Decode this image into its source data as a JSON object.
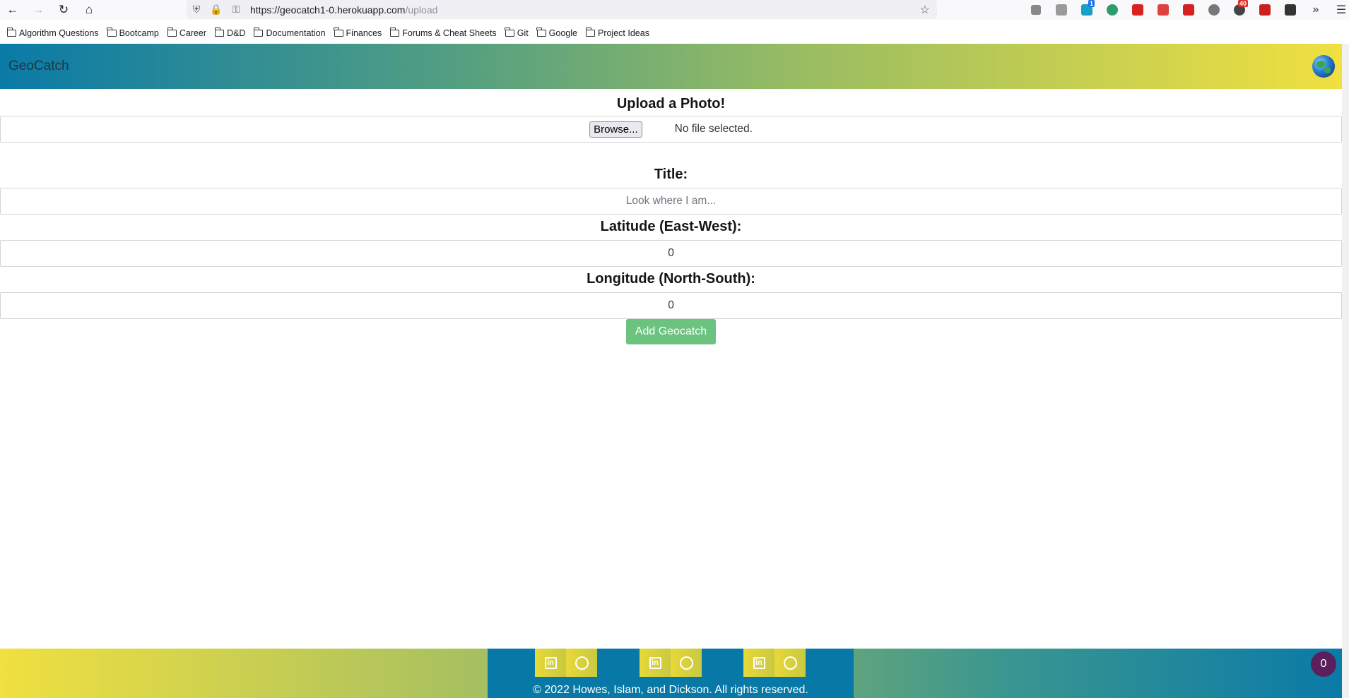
{
  "browser": {
    "url_host": "https://geocatch1-0.herokuapp.com",
    "url_path": "/upload",
    "bookmarks": [
      "Algorithm Questions",
      "Bootcamp",
      "Career",
      "D&D",
      "Documentation",
      "Finances",
      "Forums & Cheat Sheets",
      "Git",
      "Google",
      "Project Ideas"
    ],
    "ext_badges": {
      "mail": "1",
      "notif": "40"
    },
    "ext_colors": [
      "#888888",
      "#8a8a8a",
      "#1aa0c7",
      "#2c9c6a",
      "#d82121",
      "#e04040",
      "#d42121",
      "#777777",
      "#444444",
      "#cc2020",
      "#333333"
    ]
  },
  "app": {
    "brand": "GeoCatch",
    "upload_heading": "Upload a Photo!",
    "browse_label": "Browse...",
    "no_file": "No file selected.",
    "title_heading": "Title:",
    "title_placeholder": "Look where I am...",
    "lat_heading": "Latitude (East-West):",
    "lat_value": "0",
    "lon_heading": "Longitude (North-South):",
    "lon_value": "0",
    "submit_label": "Add Geocatch"
  },
  "footer": {
    "copyright": "© 2022 Howes, Islam, and Dickson. All rights reserved.",
    "badge_count": "0"
  }
}
